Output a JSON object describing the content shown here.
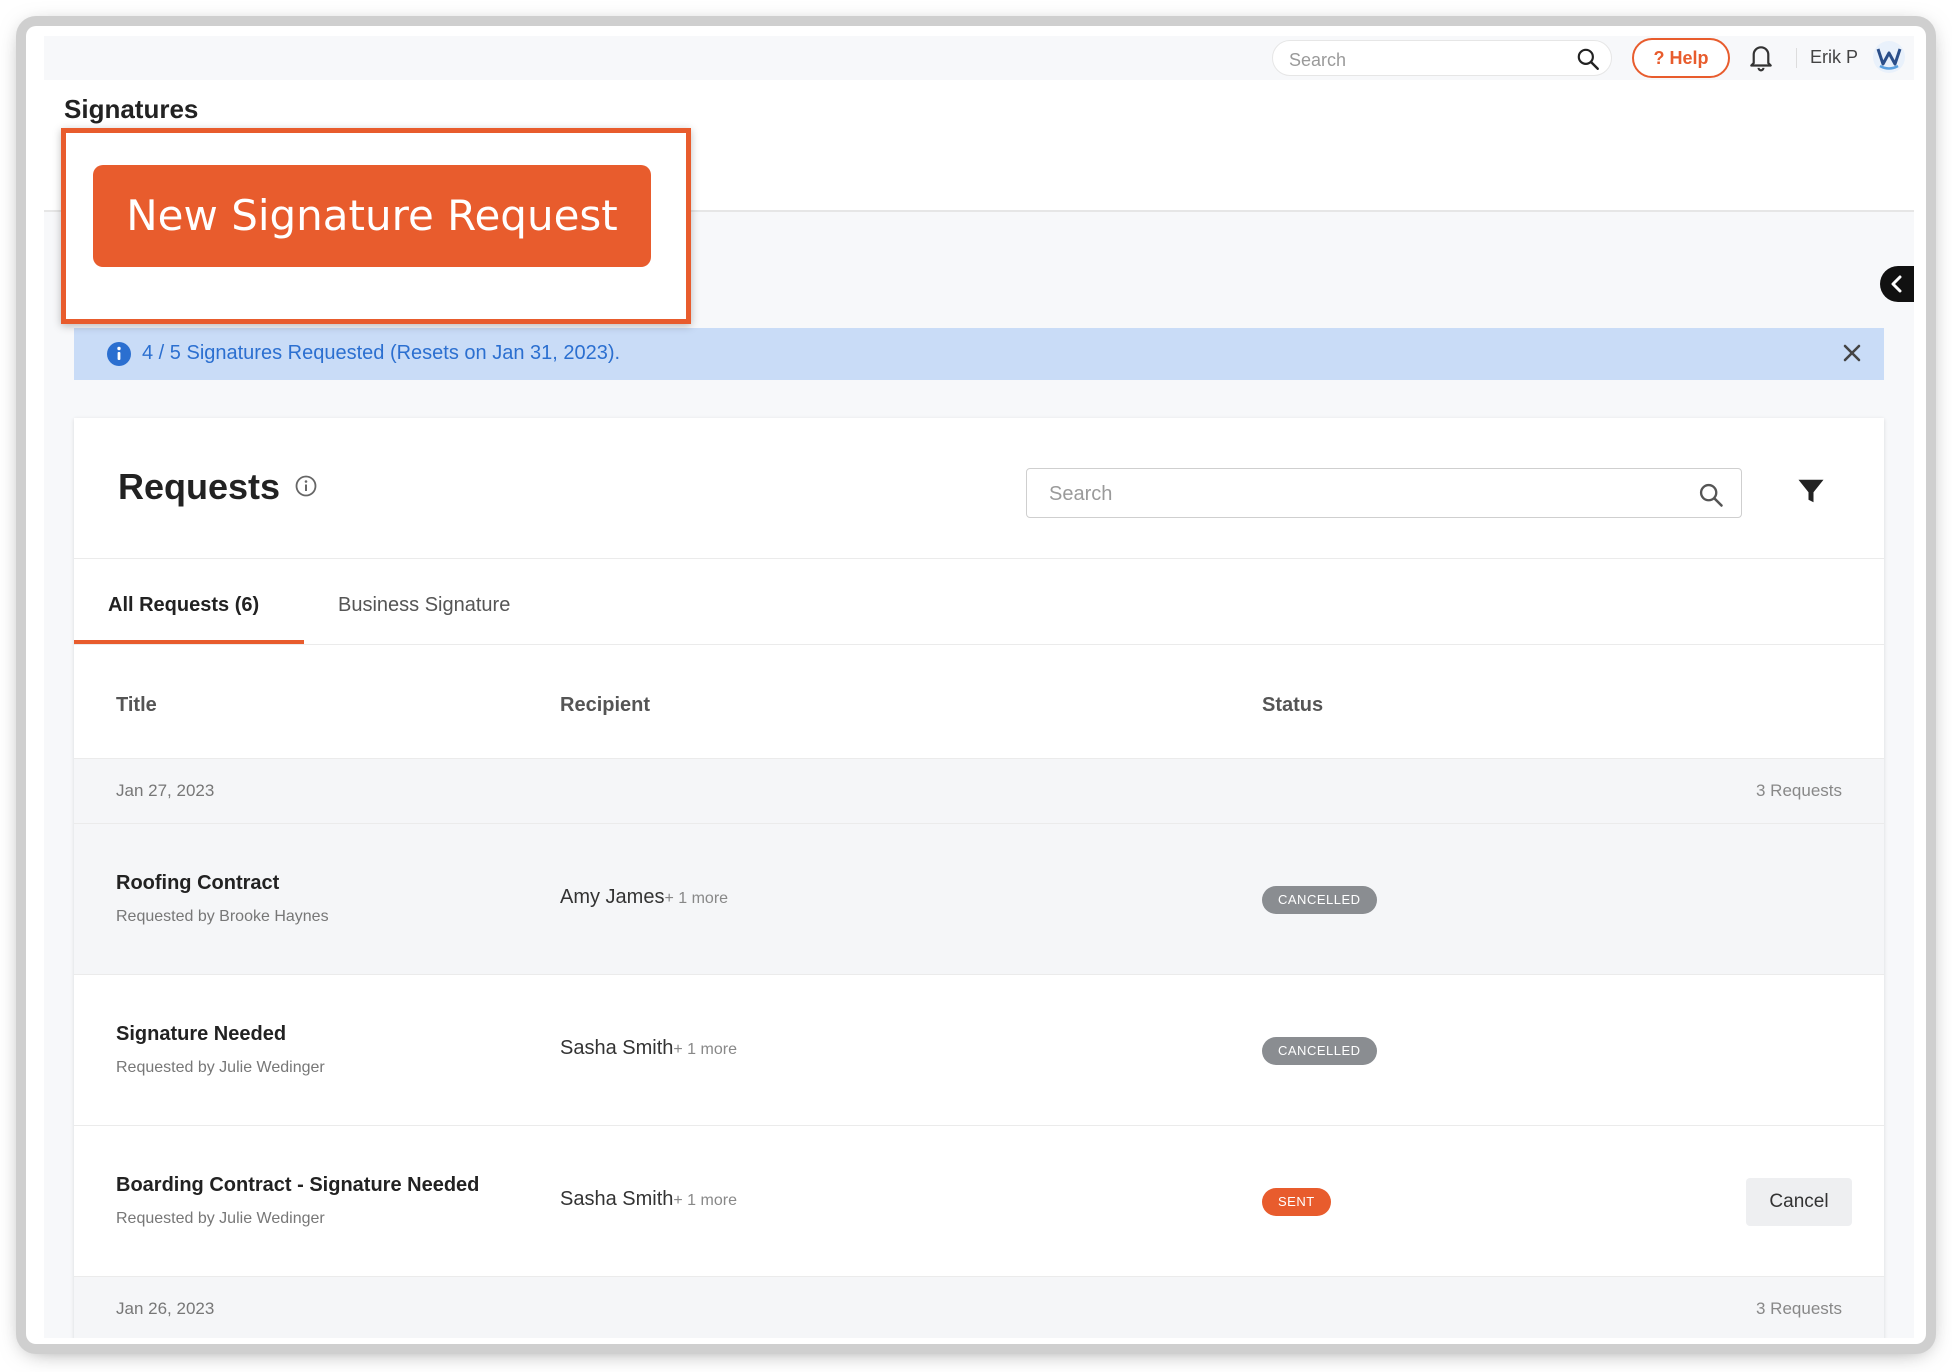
{
  "topbar": {
    "search_placeholder": "Search",
    "help_label": "? Help",
    "user_name": "Erik P"
  },
  "page": {
    "title": "Signatures",
    "new_request_label": "New Signature Request"
  },
  "banner": {
    "text": "4 / 5 Signatures Requested (Resets on Jan 31, 2023)."
  },
  "requests": {
    "title": "Requests",
    "search_placeholder": "Search",
    "tabs": [
      {
        "label": "All Requests (6)",
        "active": true
      },
      {
        "label": "Business Signature",
        "active": false
      }
    ],
    "columns": [
      "Title",
      "Recipient",
      "Status"
    ],
    "groups": [
      {
        "date": "Jan 27, 2023",
        "count": "3 Requests",
        "rows": [
          {
            "title": "Roofing Contract",
            "requested_by": "Requested by Brooke Haynes",
            "recipient": "Amy James",
            "more": "+ 1 more",
            "status": "CANCELLED"
          },
          {
            "title": "Signature Needed",
            "requested_by": "Requested by Julie Wedinger",
            "recipient": "Sasha Smith",
            "more": "+ 1 more",
            "status": "CANCELLED"
          },
          {
            "title": "Boarding Contract - Signature Needed",
            "requested_by": "Requested by Julie Wedinger",
            "recipient": "Sasha Smith",
            "more": "+ 1 more",
            "status": "SENT",
            "action": "Cancel"
          }
        ]
      },
      {
        "date": "Jan 26, 2023",
        "count": "3 Requests",
        "rows": []
      }
    ]
  },
  "colors": {
    "accent": "#e85c2d",
    "banner_bg": "#c9dcf7",
    "banner_text": "#2b6fd0",
    "badge_cancelled": "#8a8d91"
  }
}
